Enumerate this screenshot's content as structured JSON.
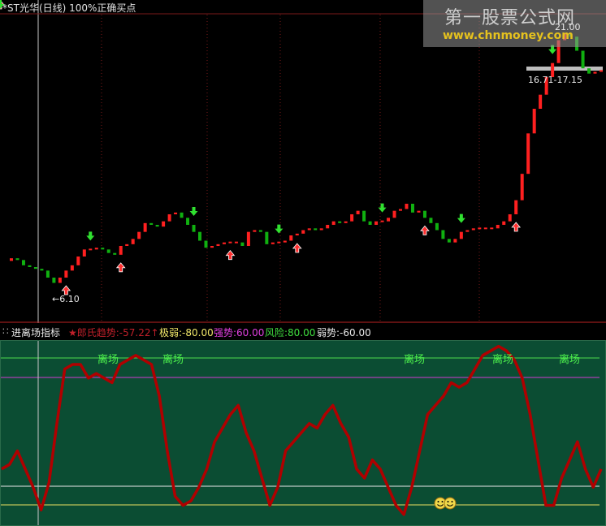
{
  "header": {
    "title": "*ST光华(日线) 100%正确买点"
  },
  "watermark": {
    "title": "第一股票公式网",
    "url": "www.chnmoney.com"
  },
  "annotations": {
    "low_label": "←6.10",
    "high_label": "21.00",
    "range_label": "16.71-17.15"
  },
  "indicator_header": {
    "name": "进离场指标",
    "items": [
      {
        "label": "★郎氏趋势:-57.22↑",
        "color": "#c0202a"
      },
      {
        "label": "极弱:-80.00",
        "color": "#f2e86a"
      },
      {
        "label": "强势:60.00",
        "color": "#e040e0"
      },
      {
        "label": "风险:80.00",
        "color": "#40e040"
      },
      {
        "label": "弱势:-60.00",
        "color": "#e8e8e8"
      }
    ]
  },
  "exit_label": "离场",
  "colors": {
    "up": "#ff2020",
    "down": "#10b010",
    "trend_line": "#b00000",
    "indicator_bg": "#0b4d33"
  },
  "chart_data": [
    {
      "type": "candlestick",
      "title": "*ST光华(日线)",
      "price_low": 6.1,
      "price_high": 21.0,
      "closes": [
        7.7,
        7.6,
        7.3,
        7.2,
        7.1,
        7.0,
        6.6,
        6.3,
        6.6,
        7.0,
        7.3,
        7.8,
        8.2,
        8.2,
        8.3,
        8.2,
        8.0,
        7.9,
        8.4,
        8.5,
        8.8,
        9.2,
        9.7,
        9.6,
        9.5,
        9.8,
        10.2,
        10.3,
        10.0,
        9.6,
        9.2,
        8.7,
        8.3,
        8.4,
        8.5,
        8.6,
        8.6,
        8.6,
        8.4,
        9.2,
        9.3,
        9.2,
        8.5,
        8.6,
        8.6,
        8.7,
        9.0,
        9.1,
        9.3,
        9.4,
        9.3,
        9.4,
        9.6,
        9.8,
        9.7,
        9.8,
        10.2,
        10.4,
        9.8,
        9.6,
        9.8,
        9.8,
        10.0,
        10.4,
        10.5,
        10.8,
        10.3,
        10.4,
        10.0,
        9.7,
        9.3,
        8.8,
        8.6,
        8.8,
        9.2,
        9.3,
        9.4,
        9.4,
        9.4,
        9.4,
        9.6,
        9.8,
        10.2,
        11.0,
        12.5,
        14.8,
        16.2,
        17.0,
        18.0,
        18.8,
        20.1,
        20.5,
        20.3,
        19.5,
        18.5,
        18.2,
        18.3,
        18.4
      ],
      "buy_signals": [
        9,
        18,
        36,
        47,
        68,
        83,
        109
      ],
      "sell_signals": [
        13,
        30,
        44,
        61,
        74,
        89,
        102
      ]
    },
    {
      "type": "line",
      "title": "进离场指标",
      "ylim": [
        -100,
        100
      ],
      "reference_lines": [
        80,
        60,
        -60,
        -80
      ],
      "series": [
        {
          "name": "郎氏趋势",
          "values": [
            -40,
            -35,
            -20,
            -40,
            -60,
            -85,
            -55,
            10,
            70,
            75,
            75,
            60,
            65,
            60,
            55,
            75,
            80,
            85,
            80,
            75,
            40,
            -20,
            -70,
            -80,
            -75,
            -60,
            -40,
            -10,
            5,
            20,
            30,
            0,
            -20,
            -50,
            -80,
            -60,
            -20,
            -10,
            0,
            10,
            5,
            20,
            30,
            10,
            -5,
            -40,
            -50,
            -30,
            -40,
            -60,
            -80,
            -90,
            -60,
            -20,
            20,
            30,
            40,
            55,
            50,
            55,
            70,
            85,
            90,
            95,
            90,
            80,
            60,
            20,
            -30,
            -80,
            -80,
            -50,
            -30,
            -10,
            -40,
            -60,
            -40
          ]
        }
      ]
    }
  ]
}
